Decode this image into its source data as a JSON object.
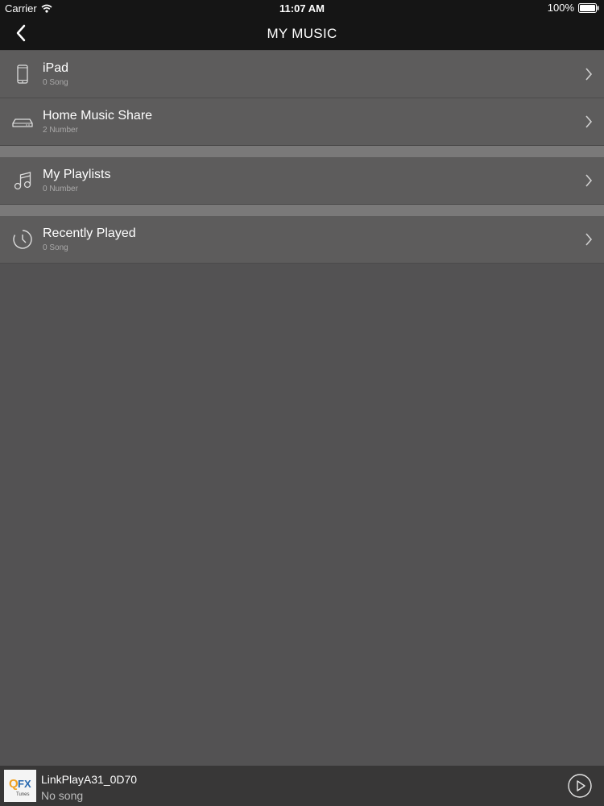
{
  "status_bar": {
    "carrier": "Carrier",
    "time": "11:07 AM",
    "battery": "100%"
  },
  "navbar": {
    "title": "MY MUSIC",
    "back_icon": "chevron-left-icon"
  },
  "list": {
    "ipad": {
      "label": "iPad",
      "sub": "0 Song",
      "icon": "tablet-icon"
    },
    "home_share": {
      "label": "Home Music Share",
      "sub": "2 Number",
      "icon": "router-icon"
    },
    "playlists": {
      "label": "My Playlists",
      "sub": "0 Number",
      "icon": "music-note-icon"
    },
    "recent": {
      "label": "Recently Played",
      "sub": "0 Song",
      "icon": "clock-icon"
    }
  },
  "now_playing": {
    "device": "LinkPlayA31_0D70",
    "song": "No song",
    "thumb_text": "QFX Tunes"
  },
  "colors": {
    "bar": "#151515",
    "background": "#535253",
    "row": "#5d5c5c",
    "separator": "#7a7979",
    "footer": "#383737"
  }
}
